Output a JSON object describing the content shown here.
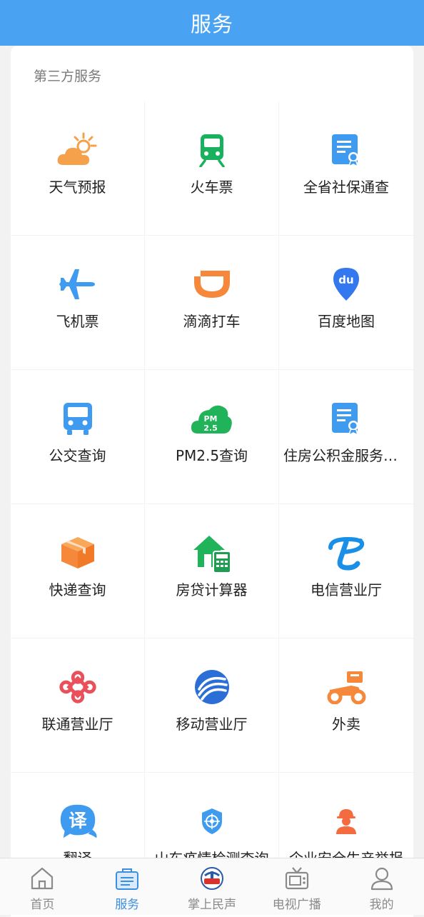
{
  "header": {
    "title": "服务"
  },
  "section": {
    "title": "第三方服务"
  },
  "services": [
    {
      "label": "天气预报",
      "icon": "weather-icon"
    },
    {
      "label": "火车票",
      "icon": "train-icon"
    },
    {
      "label": "全省社保通查",
      "icon": "certificate-icon"
    },
    {
      "label": "飞机票",
      "icon": "airplane-icon"
    },
    {
      "label": "滴滴打车",
      "icon": "didi-icon"
    },
    {
      "label": "百度地图",
      "icon": "baidu-map-icon"
    },
    {
      "label": "公交查询",
      "icon": "bus-icon"
    },
    {
      "label": "PM2.5查询",
      "icon": "pm25-icon"
    },
    {
      "label": "住房公积金服务大…",
      "icon": "certificate-icon"
    },
    {
      "label": "快递查询",
      "icon": "package-icon"
    },
    {
      "label": "房贷计算器",
      "icon": "house-calculator-icon"
    },
    {
      "label": "电信营业厅",
      "icon": "telecom-icon"
    },
    {
      "label": "联通营业厅",
      "icon": "unicom-icon"
    },
    {
      "label": "移动营业厅",
      "icon": "mobile-icon"
    },
    {
      "label": "外卖",
      "icon": "delivery-scooter-icon"
    },
    {
      "label": "翻译",
      "icon": "translate-icon"
    },
    {
      "label": "山东疫情检测查询",
      "icon": "shield-target-icon"
    },
    {
      "label": "企业安全生产举报",
      "icon": "worker-icon"
    }
  ],
  "tabs": [
    {
      "label": "首页",
      "icon": "home-icon",
      "active": false
    },
    {
      "label": "服务",
      "icon": "service-icon",
      "active": true
    },
    {
      "label": "掌上民声",
      "icon": "minsheng-logo-icon",
      "active": false
    },
    {
      "label": "电视广播",
      "icon": "tv-icon",
      "active": false
    },
    {
      "label": "我的",
      "icon": "user-icon",
      "active": false
    }
  ],
  "colors": {
    "header": "#4aa3f2",
    "active_tab": "#3a8fe0",
    "weather": "#f5a04a",
    "train": "#19b15d",
    "blue": "#3f9bf0",
    "orange": "#f5883a",
    "green": "#21b35a",
    "red": "#e9505a",
    "worker": "#f46b3f"
  }
}
